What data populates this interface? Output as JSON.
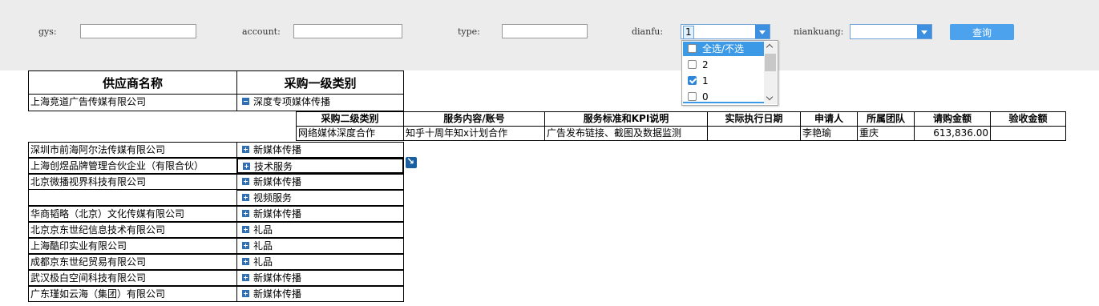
{
  "filters": {
    "gys_label": "gys:",
    "account_label": "account:",
    "type_label": "type:",
    "dianfu_label": "dianfu:",
    "niankuang_label": "niankuang:",
    "gys_value": "",
    "account_value": "",
    "type_value": "",
    "dianfu_value": "1",
    "niankuang_value": "",
    "query_label": "查询"
  },
  "dropdown": {
    "items": [
      {
        "label": "全选/不选",
        "checked": false,
        "highlighted": true
      },
      {
        "label": "2",
        "checked": false,
        "highlighted": false
      },
      {
        "label": "1",
        "checked": true,
        "highlighted": false
      },
      {
        "label": "0",
        "checked": false,
        "highlighted": false
      }
    ]
  },
  "table": {
    "headers": {
      "supplier": "供应商名称",
      "category1": "采购一级类别"
    },
    "first_row": {
      "supplier": "上海竞道广告传媒有限公司",
      "category1": "深度专项媒体传播"
    },
    "sub_headers": [
      "采购二级类别",
      "服务内容/账号",
      "服务标准和KPI说明",
      "实际执行日期",
      "申请人",
      "所属团队",
      "请购金额",
      "验收金额"
    ],
    "sub_row": [
      "网络媒体深度合作",
      "知乎十周年知x计划合作",
      "广告发布链接、截图及数据监测",
      "",
      "李艳瑜",
      "重庆",
      "613,836.00",
      ""
    ],
    "rows": [
      {
        "supplier": "深圳市前海阿尔法传媒有限公司",
        "category1": "新媒体传播"
      },
      {
        "supplier": "上海创煜品牌管理合伙企业（有限合伙）",
        "category1": "技术服务"
      },
      {
        "supplier": "北京微播视界科技有限公司",
        "category1": "新媒体传播"
      },
      {
        "supplier": "",
        "category1": "视频服务"
      },
      {
        "supplier": "华商韬略（北京）文化传媒有限公司",
        "category1": "新媒体传播"
      },
      {
        "supplier": "北京京东世纪信息技术有限公司",
        "category1": "礼品"
      },
      {
        "supplier": "上海酷印实业有限公司",
        "category1": "礼品"
      },
      {
        "supplier": "成都京东世纪贸易有限公司",
        "category1": "礼品"
      },
      {
        "supplier": "武汉极白空间科技有限公司",
        "category1": "新媒体传播"
      },
      {
        "supplier": "广东瑾如云海（集团）有限公司",
        "category1": "新媒体传播"
      }
    ]
  }
}
